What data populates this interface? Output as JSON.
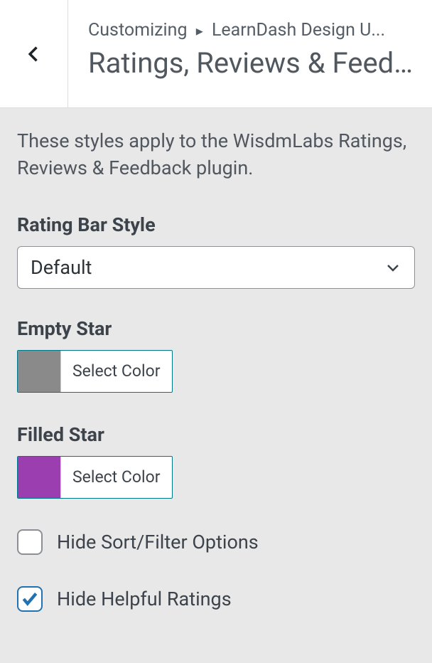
{
  "header": {
    "breadcrumb_prefix": "Customizing",
    "breadcrumb_section": "LearnDash Design U...",
    "title": "Ratings, Reviews & Feedb..."
  },
  "description": "These styles apply to the WisdmLabs Ratings, Reviews & Feedback plugin.",
  "rating_bar": {
    "label": "Rating Bar Style",
    "value": "Default"
  },
  "empty_star": {
    "label": "Empty Star",
    "button": "Select Color",
    "color": "#8a8a8a"
  },
  "filled_star": {
    "label": "Filled Star",
    "button": "Select Color",
    "color": "#9b3fb0"
  },
  "checkboxes": {
    "hide_sort_filter": {
      "label": "Hide Sort/Filter Options",
      "checked": false
    },
    "hide_helpful": {
      "label": "Hide Helpful Ratings",
      "checked": true
    }
  }
}
